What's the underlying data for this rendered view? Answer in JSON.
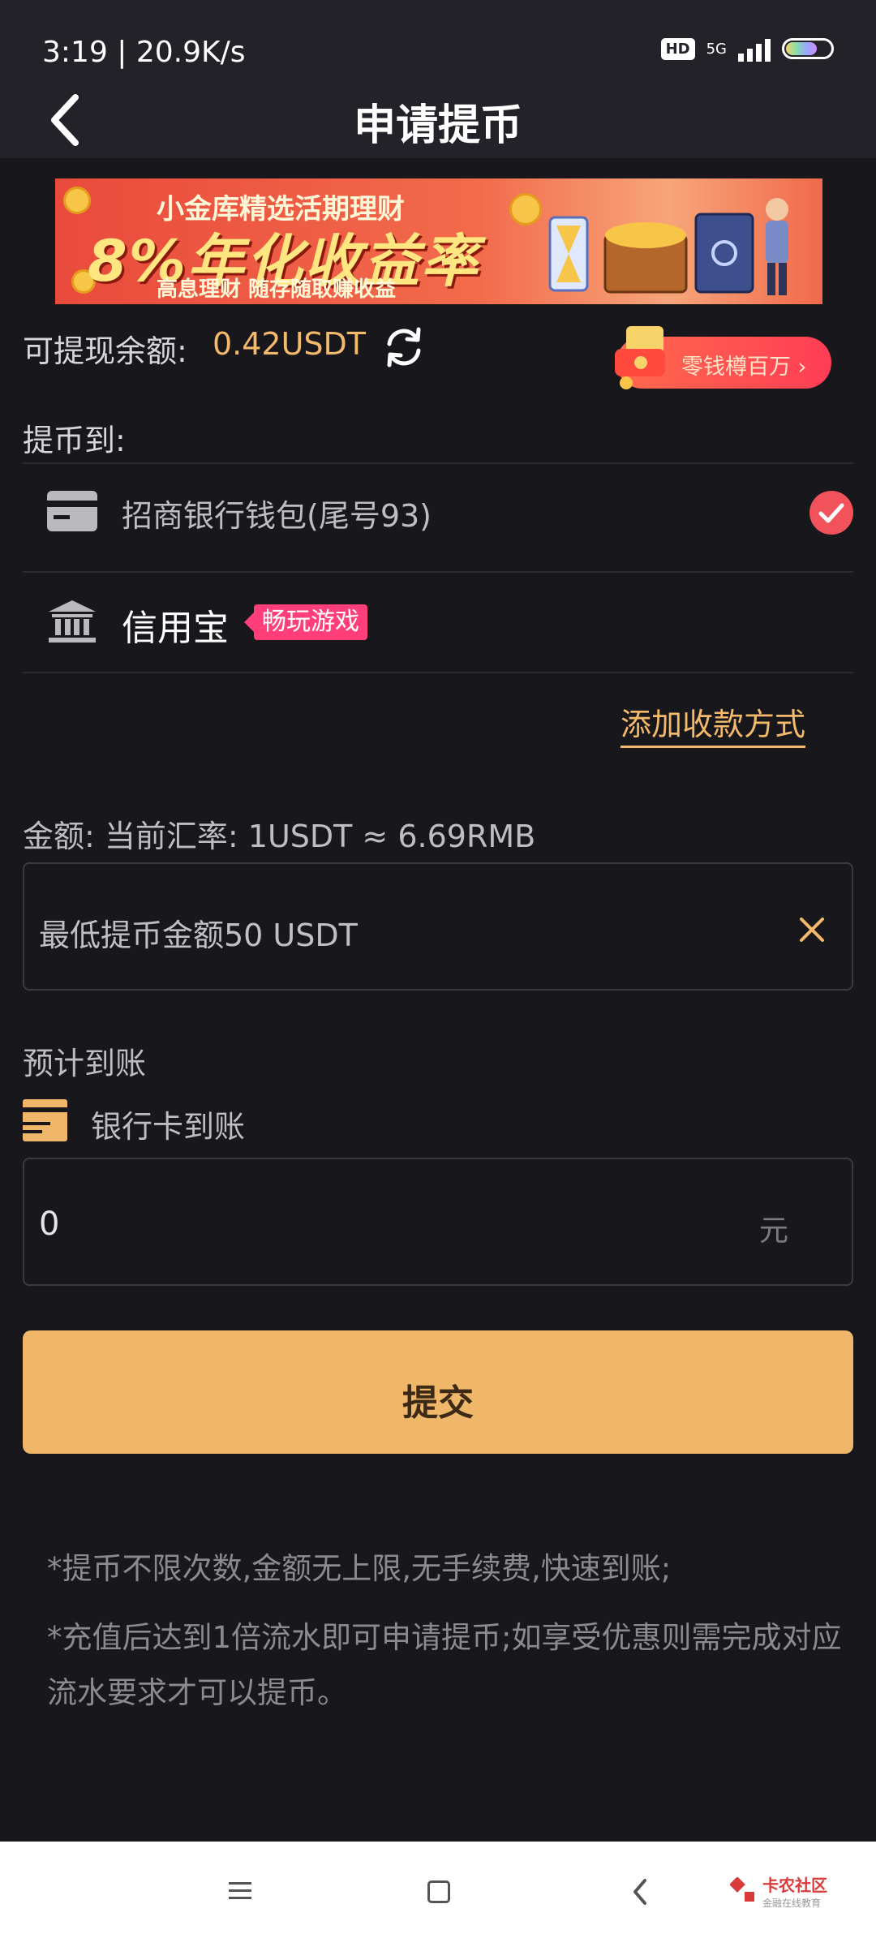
{
  "status_bar": {
    "time": "3:19 | 20.9K/s",
    "hd": "HD",
    "network": "5G"
  },
  "header": {
    "title": "申请提币"
  },
  "banner": {
    "line1": "小金库精选活期理财",
    "main": "8%年化收益率",
    "line2": "高息理财 随存随取赚收益"
  },
  "balance": {
    "label": "可提现余额:",
    "value": "0.42USDT",
    "piggy_label": "零钱樽百万 ›"
  },
  "withdraw_to": {
    "label": "提币到:",
    "methods": [
      {
        "label": "招商银行钱包(尾号93)",
        "selected": true
      },
      {
        "label": "信用宝",
        "tag": "畅玩游戏",
        "selected": false
      }
    ],
    "add_method": "添加收款方式"
  },
  "amount": {
    "label": "金额:  当前汇率: 1USDT  ≈  6.69RMB",
    "placeholder": "最低提币金额50 USDT"
  },
  "estimate": {
    "label": "预计到账",
    "card_label": "银行卡到账",
    "value": "0",
    "unit": "元"
  },
  "submit": {
    "label": "提交"
  },
  "notes": [
    "*提币不限次数,金额无上限,无手续费,快速到账;",
    "*充值后达到1倍流水即可申请提币;如享受优惠则需完成对应流水要求才可以提币。"
  ],
  "watermark": {
    "text": "卡农社区",
    "sub": "金融在线教育"
  },
  "colors": {
    "accent": "#f4b96a",
    "submit": "#f0b76a",
    "check": "#f2525a",
    "tag": "#ff3e7a",
    "background": "#17171c"
  },
  "icons": [
    "back-arrow-icon",
    "refresh-icon",
    "card-icon",
    "check-icon",
    "bank-building-icon",
    "clear-icon",
    "menu-icon",
    "home-icon",
    "back-icon"
  ]
}
